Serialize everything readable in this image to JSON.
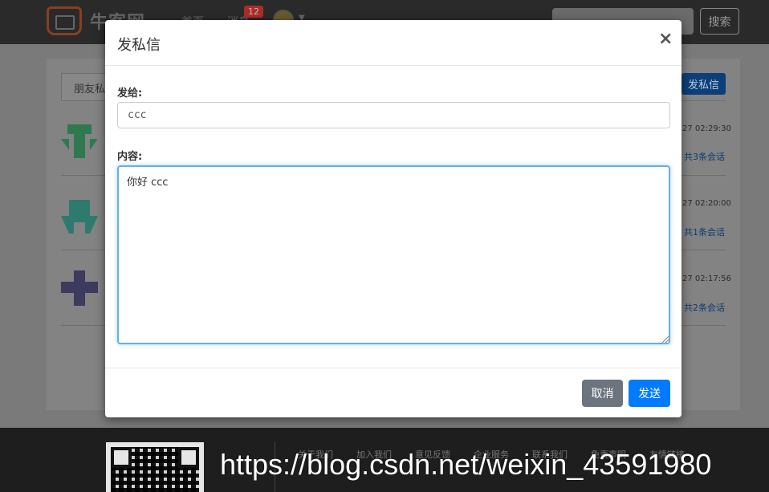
{
  "navbar": {
    "brand": "牛客网",
    "links": [
      "首页",
      "消息"
    ],
    "message_badge": "12",
    "search_button": "搜索"
  },
  "page": {
    "friend_tab": "朋友私",
    "send_button": "发私信",
    "messages": [
      {
        "time": "27 02:29:30",
        "count": "共3条会话",
        "icon_color": "#2e7a4e"
      },
      {
        "time": "27 02:20:00",
        "count": "共1条会话",
        "icon_color": "#2e7a6e"
      },
      {
        "time": "27 02:17:56",
        "count": "共2条会话",
        "icon_color": "#3c3a5e"
      }
    ]
  },
  "modal": {
    "title": "发私信",
    "close_label": "×",
    "to_label": "发给:",
    "to_value": "ccc",
    "content_label": "内容:",
    "content_value": "你好 ccc",
    "cancel_label": "取消",
    "send_label": "发送"
  },
  "footer": {
    "links": [
      "关于我们",
      "加入我们",
      "意见反馈",
      "企业服务",
      "联系我们",
      "免责声明",
      "友情链接"
    ],
    "watermark": "https://blog.csdn.net/weixin_43591980"
  },
  "colors": {
    "primary": "#007bff",
    "secondary": "#6c757d",
    "focus_border": "#66afe9"
  }
}
